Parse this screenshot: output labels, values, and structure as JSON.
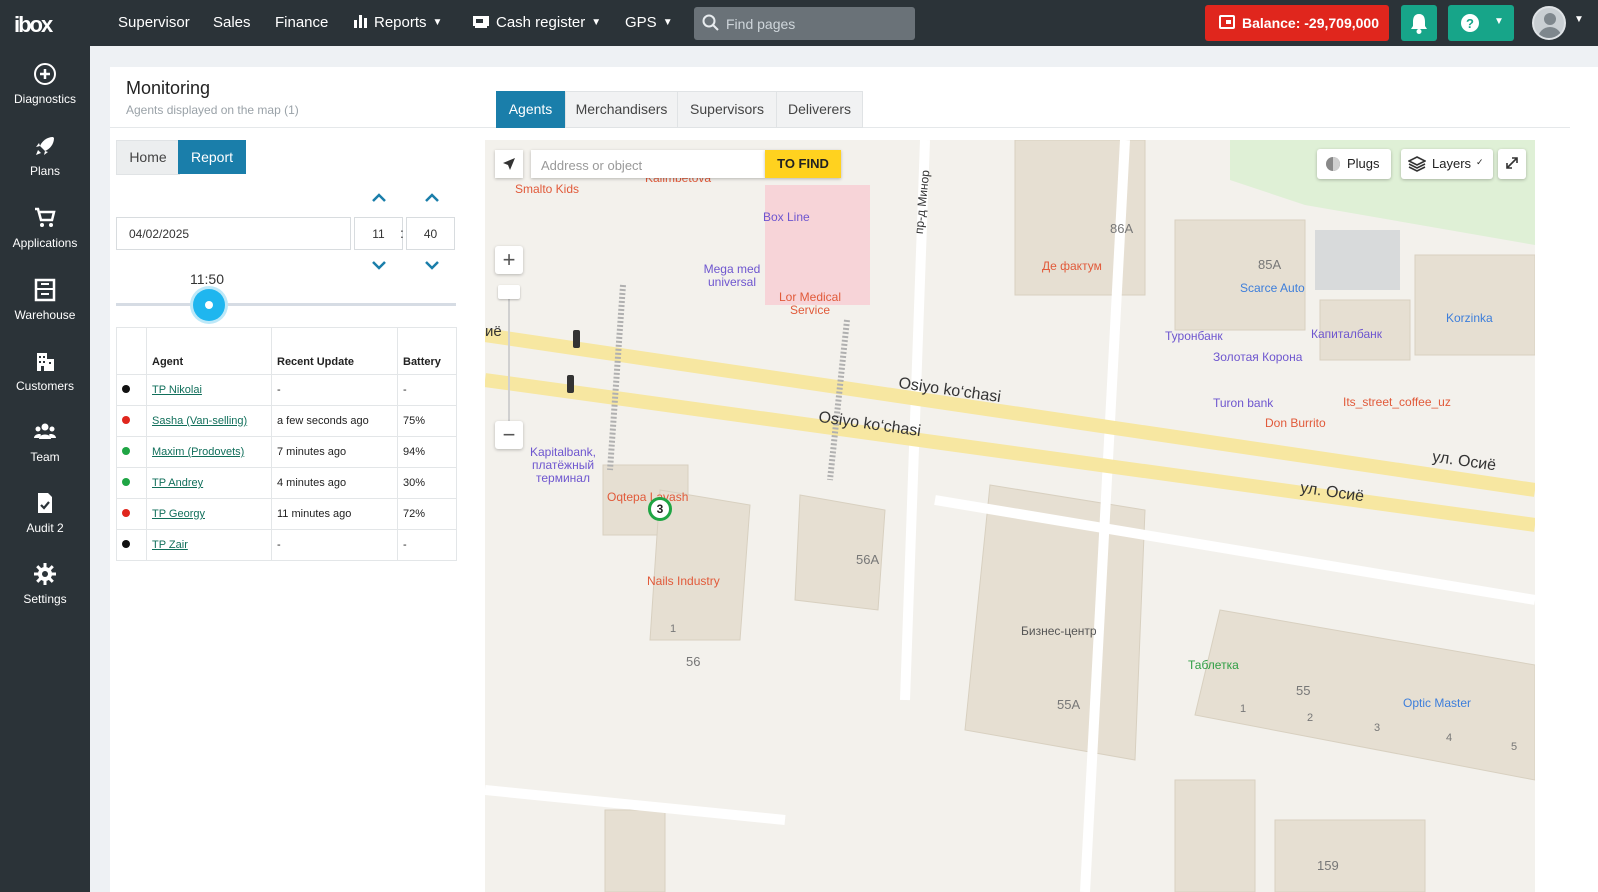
{
  "app": {
    "logo_text": "ibox"
  },
  "topnav": {
    "items": [
      {
        "label": "Supervisor",
        "dropdown": false
      },
      {
        "label": "Sales",
        "dropdown": false
      },
      {
        "label": "Finance",
        "dropdown": false
      },
      {
        "label": "Reports",
        "dropdown": true,
        "icon": "bar-chart-icon"
      },
      {
        "label": "Cash register",
        "dropdown": true,
        "icon": "cash-register-icon"
      },
      {
        "label": "GPS",
        "dropdown": true
      }
    ],
    "search_placeholder": "Find pages",
    "balance_label": "Balance: -29,709,000",
    "colors": {
      "bar": "#2b3338",
      "balance": "#e0261d",
      "action": "#17a589"
    }
  },
  "sidebar": {
    "items": [
      {
        "label": "Diagnostics",
        "icon": "plus-circle-icon"
      },
      {
        "label": "Plans",
        "icon": "rocket-icon"
      },
      {
        "label": "Applications",
        "icon": "cart-icon"
      },
      {
        "label": "Warehouse",
        "icon": "warehouse-icon"
      },
      {
        "label": "Customers",
        "icon": "building-icon"
      },
      {
        "label": "Team",
        "icon": "team-icon"
      },
      {
        "label": "Audit 2",
        "icon": "audit-document-icon"
      },
      {
        "label": "Settings",
        "icon": "gear-icon"
      }
    ]
  },
  "page": {
    "title": "Monitoring",
    "subtitle": "Agents displayed on the map (1)"
  },
  "tabs": [
    {
      "label": "Agents",
      "active": true
    },
    {
      "label": "Merchandisers",
      "active": false
    },
    {
      "label": "Supervisors",
      "active": false
    },
    {
      "label": "Deliverers",
      "active": false
    }
  ],
  "panel": {
    "home_label": "Home",
    "report_label": "Report",
    "date_value": "04/02/2025",
    "hour_value": "11",
    "minute_value": "40",
    "slider_label": "11:50",
    "table": {
      "headers": [
        "Agent",
        "Recent Update",
        "Battery"
      ],
      "rows": [
        {
          "status_color": "#111111",
          "agent": "TP Nikolai",
          "update": "-",
          "battery": "-"
        },
        {
          "status_color": "#e0261d",
          "agent": "Sasha (Van-selling)",
          "update": "a few seconds ago",
          "battery": "75%"
        },
        {
          "status_color": "#1fa544",
          "agent": "Maxim (Prodovets)",
          "update": "7 minutes ago",
          "battery": "94%"
        },
        {
          "status_color": "#1fa544",
          "agent": "TP Andrey",
          "update": "4 minutes ago",
          "battery": "30%"
        },
        {
          "status_color": "#e0261d",
          "agent": "TP Georgy",
          "update": "11 minutes ago",
          "battery": "72%"
        },
        {
          "status_color": "#111111",
          "agent": "TP Zair",
          "update": "-",
          "battery": "-"
        }
      ]
    }
  },
  "map": {
    "search_placeholder": "Address or object",
    "find_label": "TO FIND",
    "plugs_label": "Plugs",
    "layers_label": "Layers",
    "agent_marker": "3",
    "streets": [
      "Osiyo ko‘chasi",
      "Osiyo ko‘chasi",
      "ул. Осиё",
      "ул. Осиё",
      "пр-д Минор"
    ],
    "pois": [
      "Smalto Kids",
      "Kalimbetova",
      "Box Line",
      "Mega med universal",
      "Lor Medical Service",
      "Де фактум",
      "Scarce Auto",
      "Туронбанк",
      "Золотая Корона",
      "Капиталбанк",
      "Korzinka",
      "Turon bank",
      "Its_street_coffee_uz",
      "Don Burrito",
      "Kapitalbank, платёжный терминал",
      "Oqtepa Lavash",
      "Nails Industry",
      "Бизнес-центр",
      "Таблетка",
      "Optic Master"
    ],
    "building_numbers": [
      "86A",
      "85A",
      "56A",
      "56",
      "55A",
      "55",
      "159",
      "1",
      "1",
      "2",
      "3",
      "4",
      "5"
    ],
    "partial_street_text": "иё"
  }
}
